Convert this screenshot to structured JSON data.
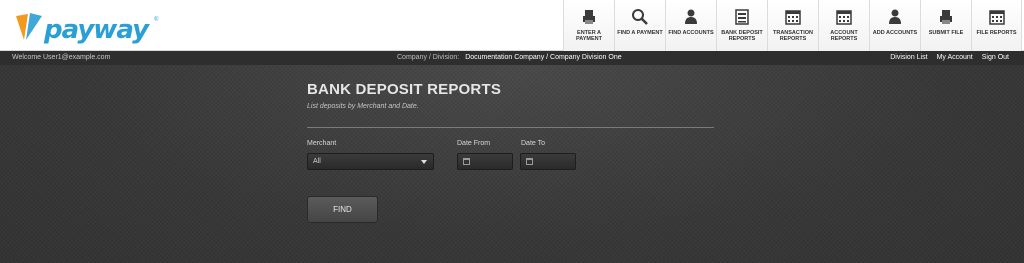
{
  "brand": {
    "name": "payway",
    "colors": {
      "text": "#2a9fd6",
      "mark_orange": "#f39a1e",
      "mark_blue": "#2a9fd6"
    }
  },
  "nav": {
    "buttons": [
      {
        "label": "ENTER A PAYMENT",
        "icon": "printer-icon"
      },
      {
        "label": "FIND A PAYMENT",
        "icon": "search-icon"
      },
      {
        "label": "FIND ACCOUNTS",
        "icon": "user-icon"
      },
      {
        "label": "BANK DEPOSIT REPORTS",
        "icon": "bank-printer-icon"
      },
      {
        "label": "TRANSACTION REPORTS",
        "icon": "calendar-icon"
      },
      {
        "label": "ACCOUNT REPORTS",
        "icon": "calendar-icon"
      },
      {
        "label": "ADD ACCOUNTS",
        "icon": "user-icon"
      },
      {
        "label": "SUBMIT FILE",
        "icon": "printer-icon"
      },
      {
        "label": "FILE REPORTS",
        "icon": "calendar-icon"
      }
    ]
  },
  "strip": {
    "welcome": "Welcome User1@example.com",
    "company_label": "Company / Division:",
    "company_value": "Documentation Company / Company Division One",
    "links": [
      "Division List",
      "My Account",
      "Sign Out"
    ]
  },
  "page": {
    "title": "BANK DEPOSIT REPORTS",
    "subtitle": "List deposits by Merchant and Date."
  },
  "form": {
    "merchant_label": "Merchant",
    "merchant_value": "All",
    "date_from_label": "Date From",
    "date_to_label": "Date To",
    "date_from_value": "",
    "date_to_value": "",
    "find_label": "FIND"
  }
}
